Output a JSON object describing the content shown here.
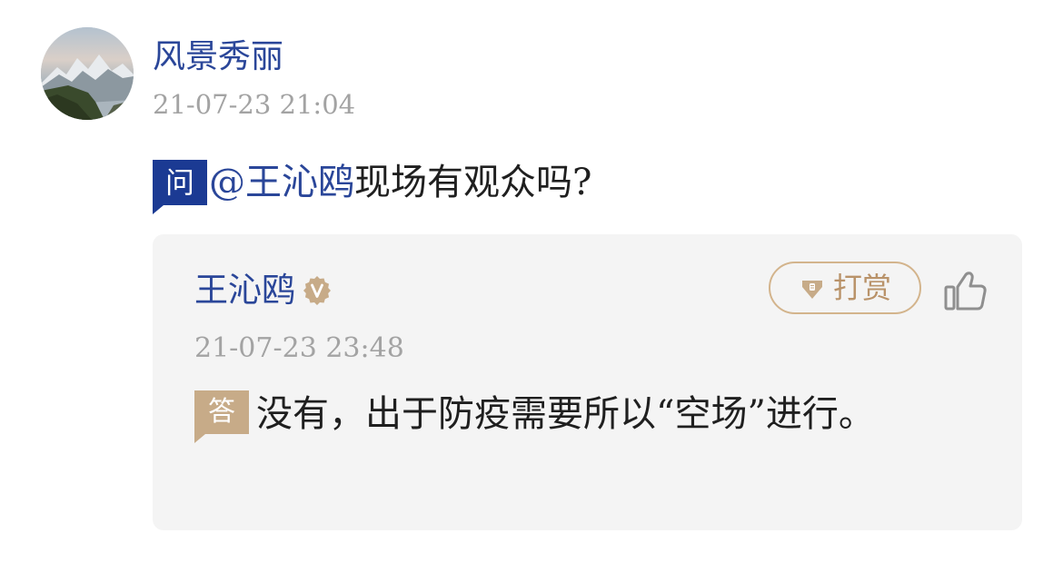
{
  "question_post": {
    "asker": {
      "name": "风景秀丽",
      "timestamp": "21-07-23 21:04"
    },
    "badge_label": "问",
    "mention": "@王沁鸥",
    "text": "现场有观众吗?"
  },
  "answer": {
    "answerer_name": "王沁鸥",
    "verified_icon": "verified-v-icon",
    "tip_button_label": "打赏",
    "tip_icon": "gem-icon",
    "like_icon": "thumbs-up-icon",
    "timestamp": "21-07-23 23:48",
    "badge_label": "答",
    "text": "没有，出于防疫需要所以“空场”进行。"
  },
  "colors": {
    "link_blue": "#2a4699",
    "question_badge": "#1b3a93",
    "answer_badge": "#c7ab88",
    "tip_accent": "#b9936a",
    "card_bg": "#f4f4f4",
    "muted_text": "#a3a3a3"
  }
}
